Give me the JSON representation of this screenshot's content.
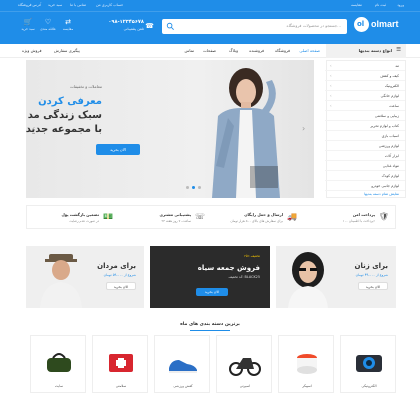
{
  "colors": {
    "brand": "#1f8de8",
    "dark": "#2b2b2b",
    "accent_yellow": "#f5c400"
  },
  "top_links": [
    "ورود",
    "ثبت نام",
    "مقایسه",
    "حساب کاربری من",
    "تماس با ما",
    "سبد خرید",
    "آدرس فروشگاه"
  ],
  "header": {
    "logo_text": "olmart",
    "search_placeholder": "جستجو در محصولات فروشگاه...",
    "phone_number": "۰۹۸-۱۲۳۴۵۶۷۸",
    "phone_label": "تلفن پشتیبانی",
    "icons": [
      {
        "icon": "cart-icon",
        "label": "سبد خرید"
      },
      {
        "icon": "heart-icon",
        "label": "علاقه مندی"
      },
      {
        "icon": "compare-icon",
        "label": "مقایسه"
      }
    ]
  },
  "nav": {
    "category_button": "انواع دسته بندیها",
    "items": [
      "صفحه اصلی",
      "فروشگاه",
      "فروشنده",
      "وبلاگ",
      "صفحات",
      "تماس"
    ],
    "tracking": "پیگیری سفارش",
    "special": "فروش ویژه"
  },
  "sidebar": {
    "items": [
      "مد",
      "کیف و کفش",
      "الکترونیک",
      "لوازم خانگی",
      "ساعت",
      "زیبایی و سلامتی",
      "کتاب و لوازم تحریر",
      "اسباب بازی",
      "لوازم ورزشی",
      "ابزار آلات",
      "مواد غذایی",
      "لوازم کودک",
      "لوازم جانبی خودرو"
    ],
    "footer_link": "نمایش تمام دسته بندیها"
  },
  "hero": {
    "small_text": "معاملات و تخفیفات",
    "line1": "معرفی کردن",
    "line2": "سبک زندگی مد",
    "line3": "با مجموعه جدید",
    "button": "الان بخرید"
  },
  "features": [
    {
      "icon": "truck-icon",
      "title": "ارسال و حمل رایگان",
      "desc": "برای سفارش های بالای ۵۰۰ هزار تومان"
    },
    {
      "icon": "support-icon",
      "title": "پشتیبانی مشتری",
      "desc": "۲۴ ساعت، ۷ روز هفته"
    },
    {
      "icon": "money-icon",
      "title": "تضمین بازگشت پول",
      "desc": "در صورت عدم رضایت"
    },
    {
      "icon": "shield-icon",
      "title": "پرداخت امن",
      "desc": "پرداخت با اطمینان ۱۰۰٪"
    }
  ],
  "promos": [
    {
      "title": "برای زنان",
      "sub": "شروع از ۴۹،۰۰۰ تومان",
      "button": "الان بخرید"
    },
    {
      "top": "۲۵٪ تخفیف",
      "title": "فروش جمعه سیاه",
      "sub": "کد تخفیف: BLACK25",
      "button": "الان بخرید"
    },
    {
      "title": "برای مردان",
      "sub": "شروع از ۵۹،۰۰۰ تومان",
      "button": "الان بخرید"
    }
  ],
  "categories_title": "برترین دسته بندی های ماه",
  "categories": [
    {
      "label": "الکترونیکی",
      "icon": "camera-icon"
    },
    {
      "label": "اسپیکر",
      "icon": "speaker-icon"
    },
    {
      "label": "اسپرتی",
      "icon": "motorcycle-icon"
    },
    {
      "label": "کفش ورزشی",
      "icon": "sneaker-icon"
    },
    {
      "label": "سلامتی",
      "icon": "health-kit-icon"
    },
    {
      "label": "سایت",
      "icon": "bag-icon"
    }
  ]
}
